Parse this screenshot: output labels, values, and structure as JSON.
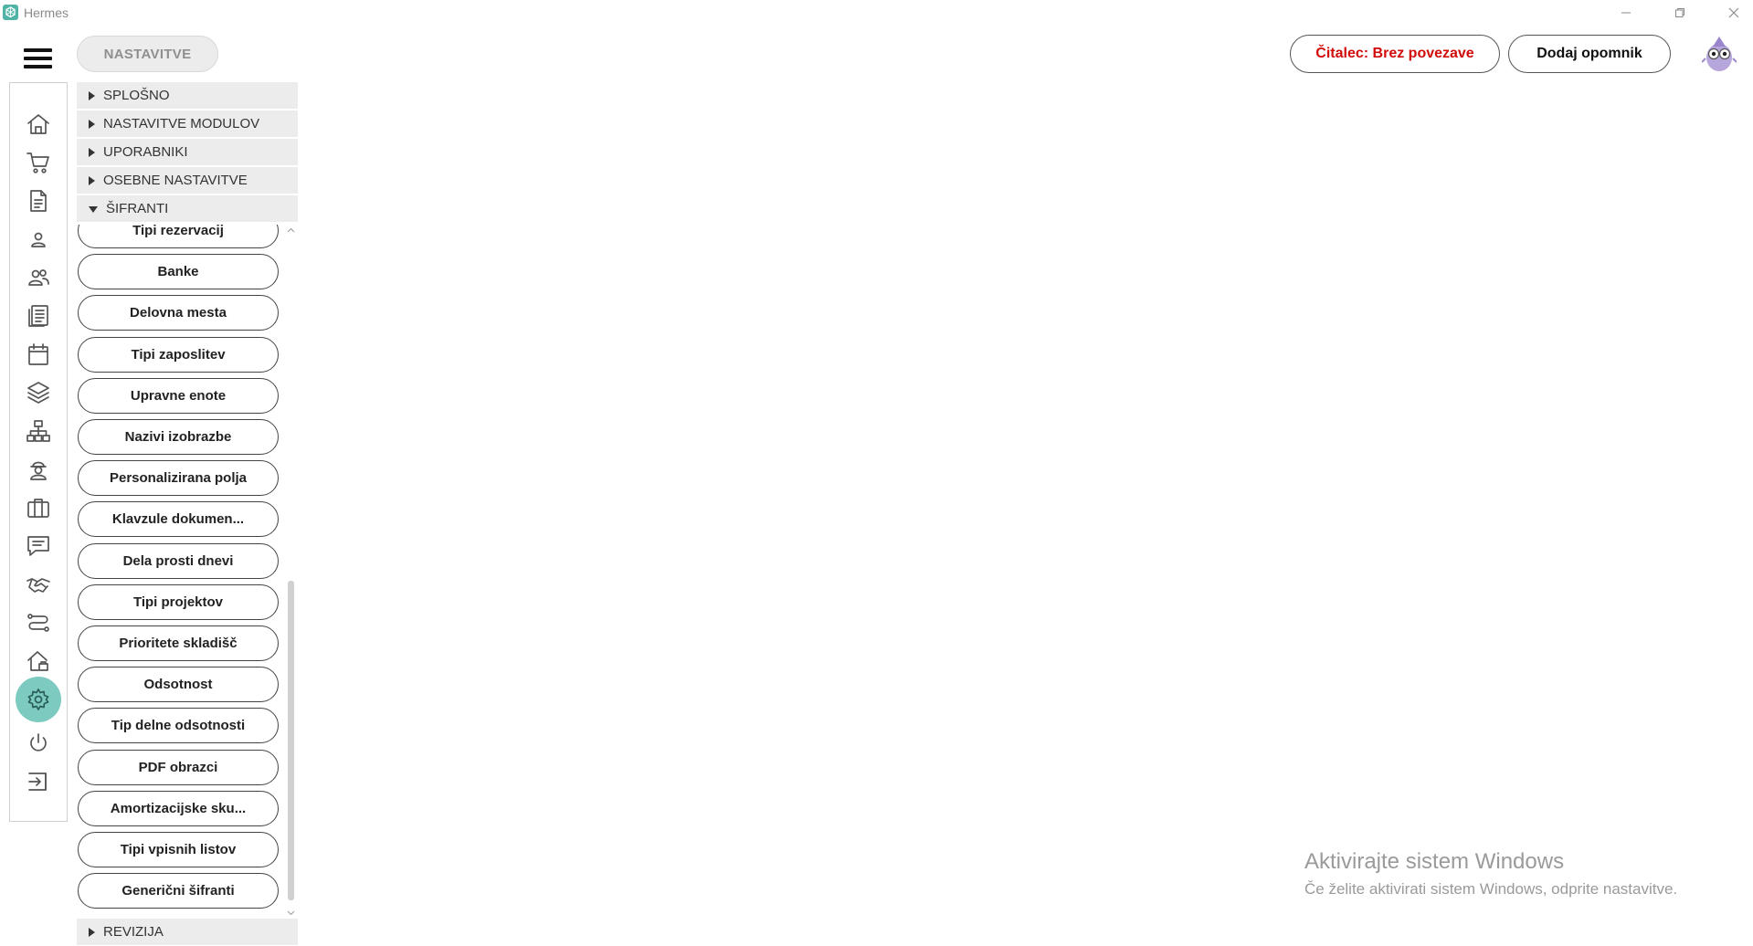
{
  "window": {
    "title": "Hermes"
  },
  "header": {
    "page_label": "NASTAVITVE",
    "reader_status": "Čitalec: Brez povezave",
    "add_reminder": "Dodaj opomnik"
  },
  "sections": [
    {
      "label": "SPLOŠNO",
      "expanded": false
    },
    {
      "label": "NASTAVITVE MODULOV",
      "expanded": false
    },
    {
      "label": "UPORABNIKI",
      "expanded": false
    },
    {
      "label": "OSEBNE NASTAVITVE",
      "expanded": false
    },
    {
      "label": "ŠIFRANTI",
      "expanded": true
    },
    {
      "label": "REVIZIJA",
      "expanded": false
    }
  ],
  "sifranti_items": [
    "Tipi rezervacij",
    "Banke",
    "Delovna mesta",
    "Tipi zaposlitev",
    "Upravne enote",
    "Nazivi izobrazbe",
    "Personalizirana polja",
    "Klavzule dokumen...",
    "Dela prosti dnevi",
    "Tipi projektov",
    "Prioritete skladišč",
    "Odsotnost",
    "Tip delne odsotnosti",
    "PDF obrazci",
    "Amortizacijske sku...",
    "Tipi vpisnih listov",
    "Generični šifranti"
  ],
  "nav_icons": [
    "home-icon",
    "cart-icon",
    "document-icon",
    "person-icon",
    "people-icon",
    "newspaper-icon",
    "calendar-icon",
    "layers-icon",
    "hierarchy-icon",
    "worker-icon",
    "briefcase-icon",
    "chat-icon",
    "handshake-icon",
    "route-icon",
    "house-icon",
    "gear-icon",
    "power-icon",
    "logout-icon"
  ],
  "activation": {
    "title": "Aktivirajte sistem Windows",
    "subtitle": "Če želite aktivirati sistem Windows, odprite nastavitve."
  },
  "colors": {
    "accent": "#7ccac0",
    "reader_status": "#d10a0a",
    "app_icon": "#4fb3a6"
  }
}
